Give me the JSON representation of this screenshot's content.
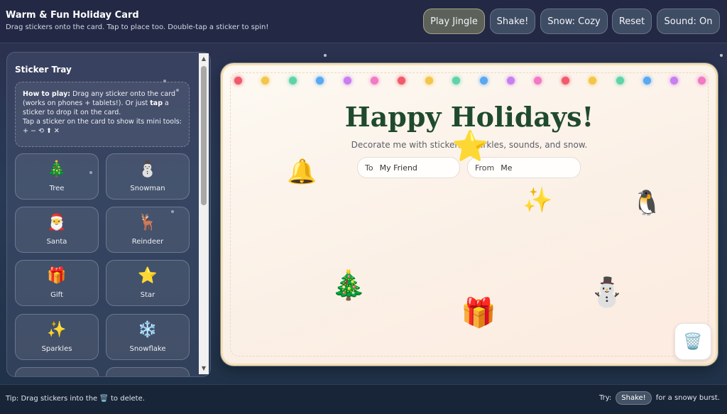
{
  "header": {
    "title": "Warm & Fun Holiday Card",
    "subtitle": "Drag stickers onto the card. Tap to place too. Double-tap a sticker to spin!",
    "buttons": {
      "play_jingle": "Play Jingle",
      "shake": "Shake!",
      "snow": "Snow: Cozy",
      "reset": "Reset",
      "sound": "Sound: On"
    }
  },
  "tray": {
    "title": "Sticker Tray",
    "howto": {
      "bold1": "How to play:",
      "text1": " Drag any sticker onto the card (works on phones + tablets!). Or just ",
      "bold2": "tap",
      "text2": " a sticker to drop it on the card.",
      "line2": "Tap a sticker on the card to show its mini tools:",
      "tools": "+ − ⟲ ⬆ ✕"
    },
    "stickers": [
      {
        "emoji": "🎄",
        "label": "Tree"
      },
      {
        "emoji": "⛄",
        "label": "Snowman"
      },
      {
        "emoji": "🎅",
        "label": "Santa"
      },
      {
        "emoji": "🦌",
        "label": "Reindeer"
      },
      {
        "emoji": "🎁",
        "label": "Gift"
      },
      {
        "emoji": "⭐",
        "label": "Star"
      },
      {
        "emoji": "✨",
        "label": "Sparkles"
      },
      {
        "emoji": "❄️",
        "label": "Snowflake"
      }
    ]
  },
  "card": {
    "title": "Happy Holidays!",
    "subtitle": "Decorate me with stickers, sparkles, sounds, and snow.",
    "to": {
      "prefix": "To",
      "value": "My Friend"
    },
    "from": {
      "prefix": "From",
      "value": "Me"
    },
    "placed_stickers": [
      {
        "name": "bell",
        "emoji": "🔔"
      },
      {
        "name": "star",
        "emoji": "⭐"
      },
      {
        "name": "sparkles",
        "emoji": "✨"
      },
      {
        "name": "penguin",
        "emoji": "🐧"
      },
      {
        "name": "tree",
        "emoji": "🎄"
      },
      {
        "name": "gift",
        "emoji": "🎁"
      },
      {
        "name": "snowman",
        "emoji": "⛄"
      }
    ],
    "trash_icon": "🗑️",
    "light_colors": [
      "#f05a6a",
      "#f3c54a",
      "#5fd3a8",
      "#5aa8f0",
      "#c97ef0",
      "#f07ac4"
    ]
  },
  "footer": {
    "tip_before": "Tip: Drag stickers into the",
    "tip_icon": "🗑️",
    "tip_after": "to delete.",
    "try_before": "Try:",
    "try_pill": "Shake!",
    "try_after": "for a snowy burst."
  }
}
